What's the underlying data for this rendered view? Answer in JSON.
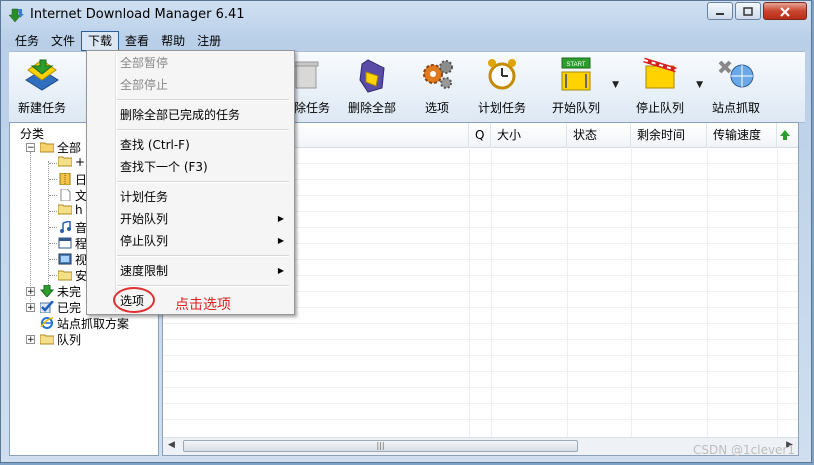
{
  "window": {
    "title": "Internet Download Manager 6.41",
    "controls": [
      "minimize",
      "maximize",
      "close"
    ]
  },
  "menubar": [
    "任务",
    "文件",
    "下载",
    "查看",
    "帮助",
    "注册"
  ],
  "toolbar": [
    {
      "label": "新建任务",
      "icon": "new-task-icon"
    },
    {
      "label": "删除任务",
      "icon": "delete-task-icon"
    },
    {
      "label": "删除全部",
      "icon": "delete-all-icon"
    },
    {
      "label": "选项",
      "icon": "options-gear-icon"
    },
    {
      "label": "计划任务",
      "icon": "scheduler-clock-icon"
    },
    {
      "label": "开始队列",
      "icon": "start-queue-icon",
      "badge": "START"
    },
    {
      "label": "停止队列",
      "icon": "stop-queue-icon"
    },
    {
      "label": "站点抓取",
      "icon": "site-grabber-icon"
    }
  ],
  "tree": {
    "header": "分类",
    "root": "全部",
    "children": [
      "+",
      "日",
      "文",
      "h",
      "音",
      "程",
      "视",
      "安"
    ],
    "unfinished": "未完",
    "finished": "已完",
    "site_grabber": "站点抓取方案",
    "queues": "队列"
  },
  "columns": [
    "Q",
    "大小",
    "状态",
    "剩余时间",
    "传输速度"
  ],
  "download_menu": {
    "items": [
      {
        "label": "全部暂停",
        "disabled": true
      },
      {
        "label": "全部停止",
        "disabled": true
      },
      {
        "label": "删除全部已完成的任务",
        "disabled": false
      },
      {
        "label": "查找 (Ctrl-F)",
        "disabled": false
      },
      {
        "label": "查找下一个 (F3)",
        "disabled": false
      },
      {
        "label": "计划任务",
        "disabled": false
      },
      {
        "label": "开始队列",
        "disabled": false,
        "submenu": true
      },
      {
        "label": "停止队列",
        "disabled": false,
        "submenu": true
      },
      {
        "label": "速度限制",
        "disabled": false,
        "submenu": true
      },
      {
        "label": "选项",
        "disabled": false
      }
    ]
  },
  "annotation": "点击选项",
  "watermark": "CSDN @1clever1",
  "colors": {
    "accent": "#e03030",
    "titlebar": "#c4d7ee"
  }
}
